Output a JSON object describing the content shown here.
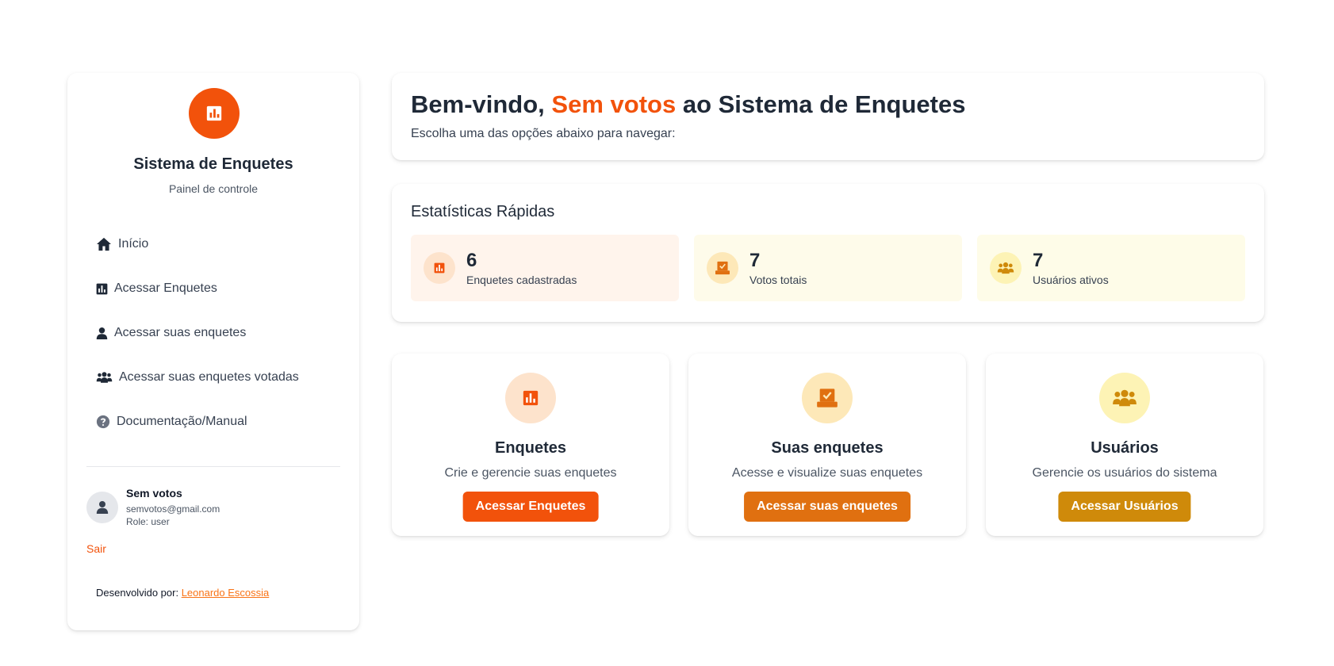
{
  "colors": {
    "primary": "#f2520b",
    "orange": "#e07010",
    "amber": "#cf8a0a",
    "stat_bg_1": "#fff4ec",
    "stat_bg_2": "#fefbea",
    "stat_bg_3": "#fefce8"
  },
  "sidebar": {
    "logo_icon": "chart-icon",
    "title": "Sistema de Enquetes",
    "subtitle": "Painel de controle",
    "items": [
      {
        "label": "Início",
        "icon": "home-icon"
      },
      {
        "label": "Acessar Enquetes",
        "icon": "chart-icon"
      },
      {
        "label": "Acessar suas enquetes",
        "icon": "user-icon"
      },
      {
        "label": "Acessar suas enquetes votadas",
        "icon": "users-icon"
      },
      {
        "label": "Documentação/Manual",
        "icon": "help-icon"
      }
    ],
    "user": {
      "name": "Sem votos",
      "email": "semvotos@gmail.com",
      "role": "Role: user"
    },
    "logout_label": "Sair",
    "credits_prefix": "Desenvolvido por:",
    "credits_author": "Leonardo Escossia"
  },
  "welcome": {
    "prefix": "Bem-vindo,",
    "username": "Sem votos",
    "suffix": "ao Sistema de Enquetes",
    "subtitle": "Escolha uma das opções abaixo para navegar:"
  },
  "stats": {
    "title": "Estatísticas Rápidas",
    "items": [
      {
        "value": "6",
        "label": "Enquetes cadastradas",
        "icon": "chart-icon"
      },
      {
        "value": "7",
        "label": "Votos totais",
        "icon": "vote-icon"
      },
      {
        "value": "7",
        "label": "Usuários ativos",
        "icon": "users-icon"
      }
    ]
  },
  "features": [
    {
      "title": "Enquetes",
      "description": "Crie e gerencie suas enquetes",
      "button": "Acessar Enquetes",
      "icon": "chart-icon"
    },
    {
      "title": "Suas enquetes",
      "description": "Acesse e visualize suas enquetes",
      "button": "Acessar suas enquetes",
      "icon": "vote-icon"
    },
    {
      "title": "Usuários",
      "description": "Gerencie os usuários do sistema",
      "button": "Acessar Usuários",
      "icon": "users-icon"
    }
  ]
}
